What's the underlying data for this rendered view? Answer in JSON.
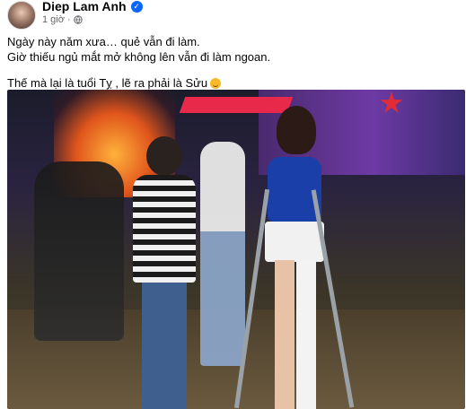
{
  "post": {
    "author": "Diep Lam Anh",
    "time": "1 giờ",
    "privacy_icon": "globe-icon",
    "text": {
      "line1": "Ngày này năm xưa… quẻ vẫn đi làm.",
      "line2": "Giờ thiếu ngủ mắt mở không lên vẫn đi làm ngoan.",
      "line3": "Thế mà lại là tuổi Tỵ , lẽ ra phải là Sửu"
    }
  },
  "colors": {
    "verified": "#0866ff",
    "meta": "#65676b"
  }
}
